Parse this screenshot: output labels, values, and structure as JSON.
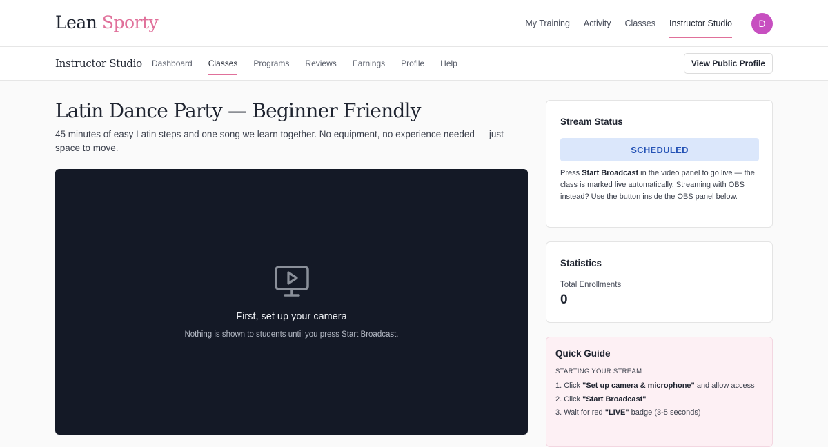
{
  "brand": {
    "part1": "Lean",
    "part2": "Sporty"
  },
  "top_nav": {
    "items": [
      {
        "label": "My Training"
      },
      {
        "label": "Activity"
      },
      {
        "label": "Classes"
      },
      {
        "label": "Instructor Studio",
        "active": true
      }
    ],
    "avatar_initial": "D",
    "avatar_color": "#c74fc0"
  },
  "sub_header": {
    "title": "Instructor Studio",
    "tabs": [
      {
        "label": "Dashboard"
      },
      {
        "label": "Classes",
        "active": true
      },
      {
        "label": "Programs"
      },
      {
        "label": "Reviews"
      },
      {
        "label": "Earnings"
      },
      {
        "label": "Profile"
      },
      {
        "label": "Help"
      }
    ],
    "public_profile_button": "View Public Profile"
  },
  "class": {
    "title": "Latin Dance Party — Beginner Friendly",
    "description": "45 minutes of easy Latin steps and one song we learn together. No equipment, no experience needed — just space to move."
  },
  "video_panel": {
    "icon": "monitor-play-icon",
    "title": "First, set up your camera",
    "subtitle": "Nothing is shown to students until you press Start Broadcast."
  },
  "stream_status": {
    "heading": "Stream Status",
    "status": "SCHEDULED",
    "status_color": "#2452b5",
    "help_pre": "Press ",
    "help_bold": "Start Broadcast",
    "help_post": " in the video panel to go live — the class is marked live automatically. Streaming with OBS instead? Use the button inside the OBS panel below."
  },
  "statistics": {
    "heading": "Statistics",
    "total_enrollments_label": "Total Enrollments",
    "total_enrollments_value": "0"
  },
  "quick_guide": {
    "heading": "Quick Guide",
    "section": "STARTING YOUR STREAM",
    "steps": [
      {
        "pre": "1. Click ",
        "bold": "\"Set up camera & microphone\"",
        "post": " and allow access"
      },
      {
        "pre": "2. Click ",
        "bold": "\"Start Broadcast\"",
        "post": ""
      },
      {
        "pre": "3. Wait for red ",
        "bold": "\"LIVE\"",
        "post": " badge (3-5 seconds)"
      }
    ]
  },
  "accent_color": "#e0709a"
}
